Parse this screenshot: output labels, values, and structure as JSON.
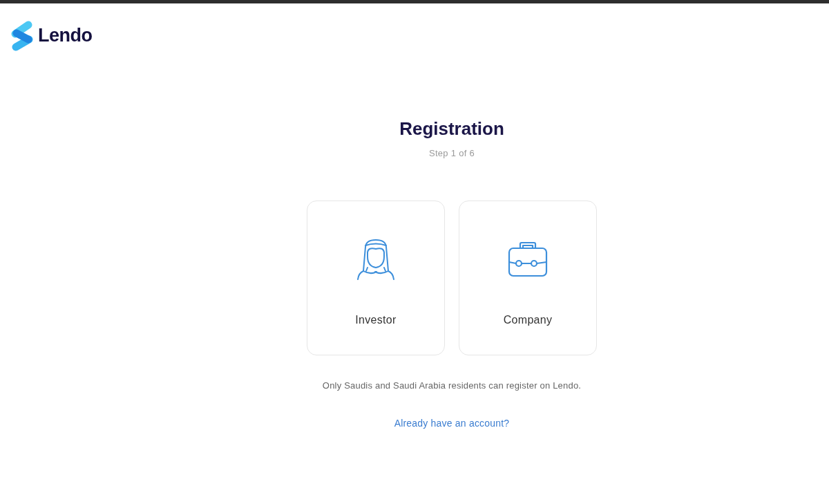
{
  "logo": {
    "text": "Lendo"
  },
  "title": "Registration",
  "step": "Step 1 of 6",
  "options": [
    {
      "kind": "investor",
      "label": "Investor",
      "selected": false
    },
    {
      "kind": "company",
      "label": "Company",
      "selected": false
    }
  ],
  "note": "Only Saudis and Saudi Arabia residents can register on Lendo.",
  "login_link": "Already have an account?"
}
